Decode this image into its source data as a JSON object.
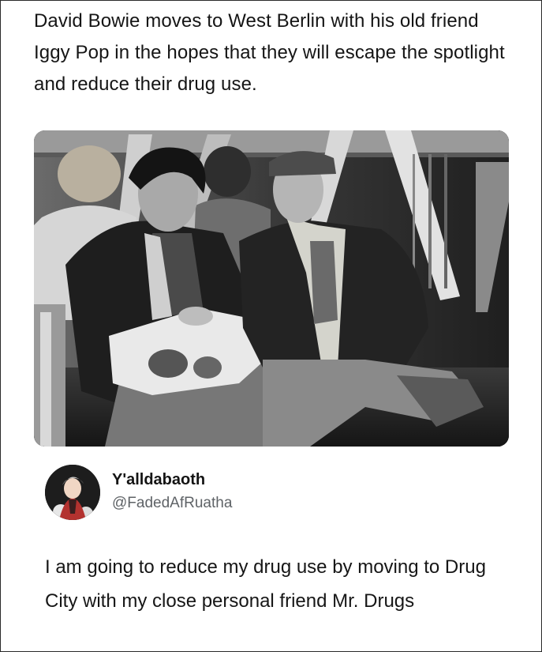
{
  "post": {
    "headline": "David Bowie moves to West Berlin with his old friend Iggy Pop in the hopes that they will escape the spotlight and reduce their drug use."
  },
  "reply": {
    "display_name": "Y'alldabaoth",
    "handle": "@FadedAfRuatha",
    "text": "I am going to reduce my drug use by moving to Drug City with my close personal friend Mr. Drugs"
  }
}
